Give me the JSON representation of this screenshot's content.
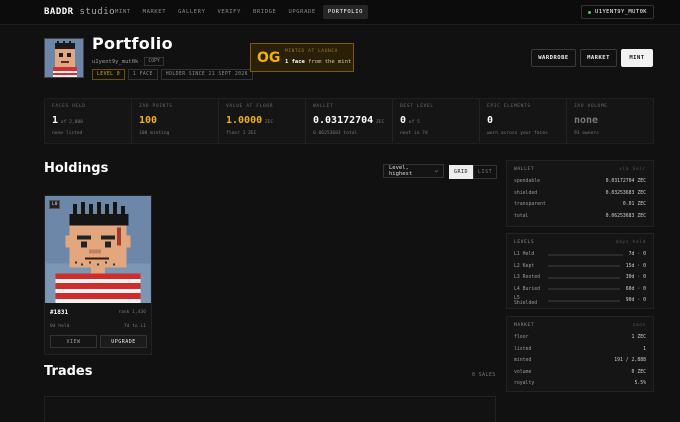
{
  "nav": {
    "logo_main": "BADDR",
    "logo_sub": "studio",
    "links": [
      "MINT",
      "MARKET",
      "GALLERY",
      "VERIFY",
      "BRIDGE",
      "UPGRADE",
      "PORTFOLIO"
    ],
    "active": "PORTFOLIO",
    "wallet": "U1YENT9Y_MUT0K"
  },
  "header": {
    "title": "Portfolio",
    "handle": "u1yent9y_mut0k",
    "copy_label": "COPY",
    "badges": [
      "LEVEL 0",
      "1 FACE",
      "HOLDER SINCE 21 SEPT 2026"
    ],
    "og": {
      "big": "OG",
      "small": "MINTED AT LAUNCH",
      "count": "1 face",
      "rest": " from the mint"
    },
    "actions": {
      "wardrobe": "WARDROBE",
      "market": "MARKET",
      "mint": "MINT"
    }
  },
  "stats": [
    {
      "label": "FACES HELD",
      "value": "1",
      "unit": " of 2,888",
      "sub": "none listed",
      "style": ""
    },
    {
      "label": "ZAO POINTS",
      "value": "100",
      "unit": "",
      "sub": "100 minting",
      "style": "gold"
    },
    {
      "label": "VALUE AT FLOOR",
      "value": "1.0000",
      "unit": " ZEC",
      "sub": "floor 1 ZEC",
      "style": "gold"
    },
    {
      "label": "WALLET",
      "value": "0.03172704",
      "unit": " ZEC",
      "sub": "0.06253683 total",
      "style": ""
    },
    {
      "label": "BEST LEVEL",
      "value": "0",
      "unit": " of 5",
      "sub": "next in 7d",
      "style": ""
    },
    {
      "label": "EPIC ELEMENTS",
      "value": "0",
      "unit": "",
      "sub": "worn across your faces",
      "style": ""
    },
    {
      "label": "ZAO VOLUME",
      "value": "none",
      "unit": "",
      "sub": "93 owners",
      "style": "muted"
    }
  ],
  "holdings": {
    "title": "Holdings",
    "sort_label": "Level, highest",
    "view_grid": "GRID",
    "view_list": "LIST",
    "card": {
      "level_tag": "L0",
      "name": "#1831",
      "rank": "rank 1,436",
      "held": "0d held",
      "to_next": "7d to L1",
      "view_label": "VIEW",
      "upgrade_label": "UPGRADE"
    }
  },
  "trades": {
    "title": "Trades",
    "count": "0 SALES"
  },
  "wallet_panel": {
    "title": "WALLET",
    "note": "via Seir",
    "rows": [
      {
        "k": "spendable",
        "v": "0.03172704 ZEC"
      },
      {
        "k": "shielded",
        "v": "0.03253683 ZEC"
      },
      {
        "k": "transparent",
        "v": "0.01 ZEC"
      },
      {
        "k": "total",
        "v": "0.06253683 ZEC"
      }
    ]
  },
  "levels_panel": {
    "title": "LEVELS",
    "note": "days held",
    "rows": [
      {
        "k": "L1 Held",
        "v": "7d · 0",
        "progress": 0.0
      },
      {
        "k": "L2 Kept",
        "v": "15d · 0",
        "progress": 0.0
      },
      {
        "k": "L3 Rooted",
        "v": "30d · 0",
        "progress": 0.0
      },
      {
        "k": "L4 Buried",
        "v": "60d · 0",
        "progress": 0.0
      },
      {
        "k": "L5 Shielded",
        "v": "90d · 0",
        "progress": 0.0
      }
    ]
  },
  "market_panel": {
    "title": "MARKET",
    "note": "zaos",
    "rows": [
      {
        "k": "floor",
        "v": "1 ZEC"
      },
      {
        "k": "listed",
        "v": "1"
      },
      {
        "k": "minted",
        "v": "191 / 2,888"
      },
      {
        "k": "volume",
        "v": "0 ZEC"
      },
      {
        "k": "royalty",
        "v": "5.5%"
      }
    ]
  }
}
